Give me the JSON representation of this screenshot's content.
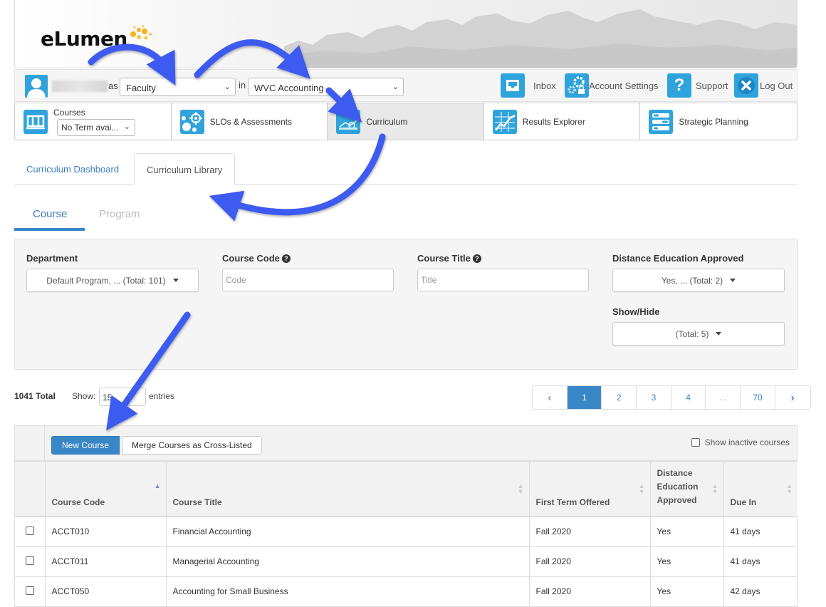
{
  "brand": {
    "logo_text": "eLumen"
  },
  "userbar": {
    "as_label": "as",
    "role": "Faculty",
    "in_label": "in",
    "unit": "WVC Accounting",
    "actions": [
      {
        "label": "Inbox",
        "icon": "inbox-icon"
      },
      {
        "label": "Account Settings",
        "icon": "gears-lock-icon"
      },
      {
        "label": "Support",
        "icon": "question-icon"
      },
      {
        "label": "Log Out",
        "icon": "close-icon"
      }
    ]
  },
  "modules": [
    {
      "label": "Courses",
      "icon": "courses-icon",
      "term_select": "No Term avai..."
    },
    {
      "label": "SLOs & Assessments",
      "icon": "target-bubbles-icon"
    },
    {
      "label": "Curriculum",
      "icon": "curriculum-icon",
      "active": true
    },
    {
      "label": "Results Explorer",
      "icon": "chart-grid-icon"
    },
    {
      "label": "Strategic Planning",
      "icon": "sliders-icon"
    }
  ],
  "subtabs": [
    {
      "label": "Curriculum Dashboard"
    },
    {
      "label": "Curriculum Library",
      "active": true
    }
  ],
  "type_tabs": [
    {
      "label": "Course",
      "active": true
    },
    {
      "label": "Program"
    }
  ],
  "filters": {
    "department": {
      "label": "Department",
      "value": "Default Program, ... (Total: 101)"
    },
    "course_code": {
      "label": "Course Code",
      "placeholder": "Code",
      "value": ""
    },
    "course_title": {
      "label": "Course Title",
      "placeholder": "Title",
      "value": ""
    },
    "distance_ed": {
      "label": "Distance Education Approved",
      "value": "Yes, ... (Total: 2)"
    },
    "show_hide": {
      "label": "Show/Hide",
      "value": "(Total: 5)"
    }
  },
  "listing": {
    "total": "1041 Total",
    "show_label": "Show:",
    "entries_value": "15",
    "entries_label": "entries"
  },
  "pagination": {
    "prev": "‹",
    "pages": [
      "1",
      "2",
      "3",
      "4",
      "...",
      "70"
    ],
    "current": "1",
    "next": "›"
  },
  "toolbar": {
    "new_course": "New Course",
    "merge": "Merge Courses as Cross-Listed",
    "show_inactive": "Show inactive courses"
  },
  "table": {
    "columns": [
      "Course Code",
      "Course Title",
      "First Term Offered",
      "Distance Education Approved",
      "Due In"
    ],
    "sorted_column": "Course Code",
    "sort_direction": "asc",
    "rows": [
      {
        "code": "ACCT010",
        "title": "Financial Accounting",
        "term": "Fall 2020",
        "de": "Yes",
        "due": "41 days"
      },
      {
        "code": "ACCT011",
        "title": "Managerial Accounting",
        "term": "Fall 2020",
        "de": "Yes",
        "due": "41 days"
      },
      {
        "code": "ACCT050",
        "title": "Accounting for Small Business",
        "term": "Fall 2020",
        "de": "Yes",
        "due": "42 days"
      }
    ]
  },
  "colors": {
    "accent": "#3a87c8",
    "icon_blue": "#2fa3dc",
    "link": "#3a7fc1",
    "annotation_arrow": "#3d5af1"
  }
}
